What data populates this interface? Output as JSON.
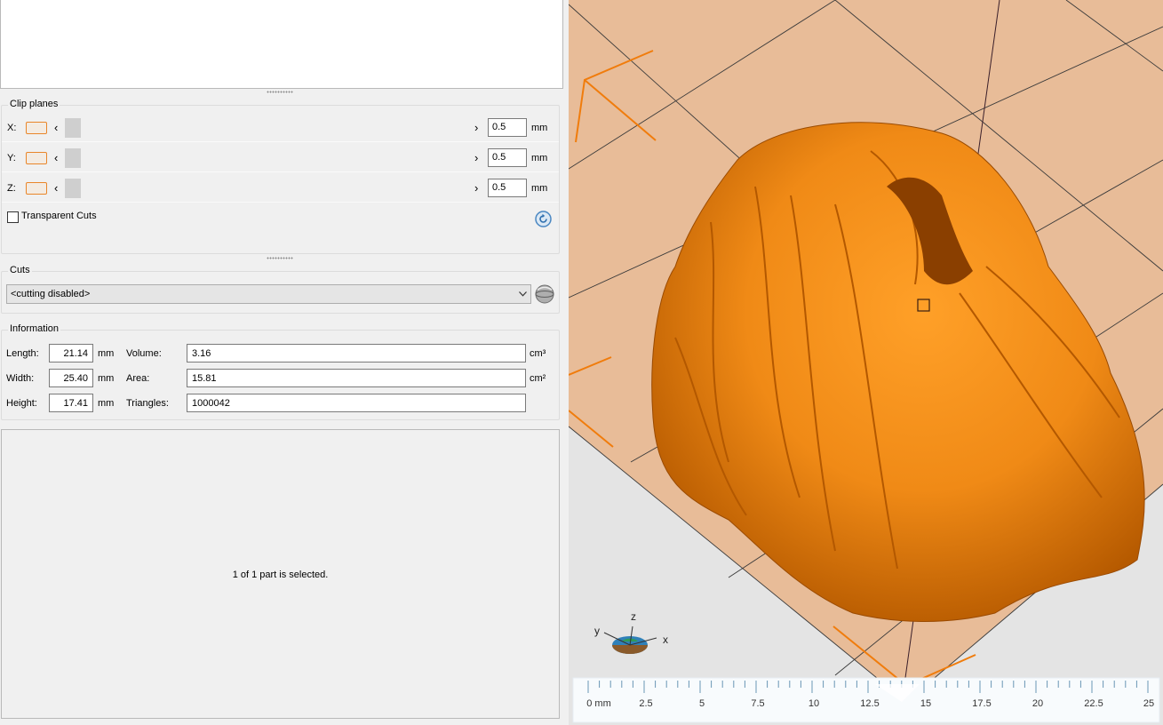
{
  "clip_planes": {
    "title": "Clip planes",
    "rows": [
      {
        "axis": "X:",
        "value": "0.5",
        "unit": "mm"
      },
      {
        "axis": "Y:",
        "value": "0.5",
        "unit": "mm"
      },
      {
        "axis": "Z:",
        "value": "0.5",
        "unit": "mm"
      }
    ],
    "transparent_cuts_label": "Transparent Cuts"
  },
  "cuts": {
    "title": "Cuts",
    "selected": "<cutting disabled>"
  },
  "information": {
    "title": "Information",
    "length_label": "Length:",
    "length": "21.14",
    "length_unit": "mm",
    "width_label": "Width:",
    "width": "25.40",
    "width_unit": "mm",
    "height_label": "Height:",
    "height": "17.41",
    "height_unit": "mm",
    "volume_label": "Volume:",
    "volume": "3.16",
    "volume_unit": "cm³",
    "area_label": "Area:",
    "area": "15.81",
    "area_unit": "cm²",
    "triangles_label": "Triangles:",
    "triangles": "1000042"
  },
  "status_text": "1 of 1 part is selected.",
  "viewport": {
    "axis_labels": {
      "x": "x",
      "y": "y",
      "z": "z"
    },
    "ruler_labels": [
      "0 mm",
      "2.5",
      "5",
      "7.5",
      "10",
      "12.5",
      "15",
      "17.5",
      "20",
      "22.5",
      "25"
    ],
    "bed_color": "#e8bc98",
    "model_color": "#f08a16",
    "accent_color": "#f07c0c"
  }
}
